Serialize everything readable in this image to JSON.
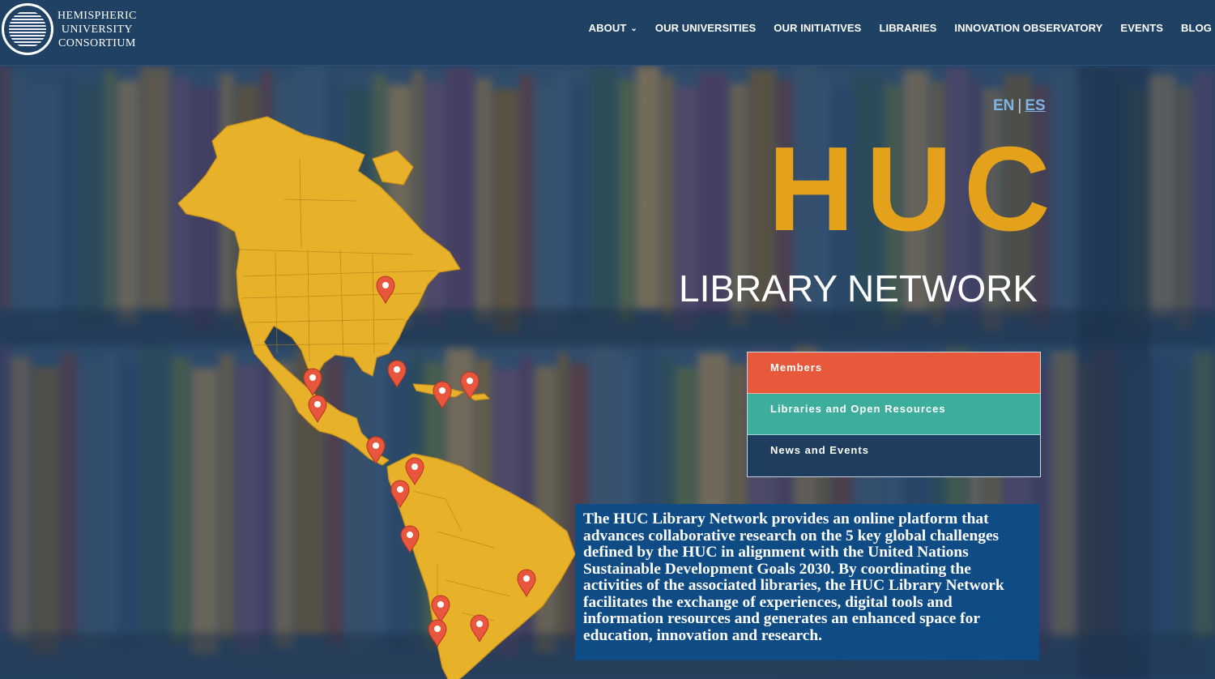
{
  "header": {
    "logo_lines": [
      "HEMISPHERIC",
      "UNIVERSITY",
      "CONSORTIUM"
    ],
    "nav": [
      {
        "label": "ABOUT",
        "has_dropdown": true
      },
      {
        "label": "OUR UNIVERSITIES"
      },
      {
        "label": "OUR INITIATIVES"
      },
      {
        "label": "LIBRARIES"
      },
      {
        "label": "INNOVATION OBSERVATORY"
      },
      {
        "label": "EVENTS"
      },
      {
        "label": "BLOG"
      }
    ]
  },
  "hero": {
    "lang": {
      "en": "EN",
      "separator": "|",
      "es": "ES"
    },
    "title": "HUC",
    "subtitle": "LIBRARY NETWORK",
    "menu": [
      {
        "label": "Members",
        "color": "#e8593b"
      },
      {
        "label": "Libraries and Open Resources",
        "color": "#3dae9c"
      },
      {
        "label": "News and Events",
        "color": "#1f3d5e"
      }
    ],
    "description": "The HUC Library Network provides an online platform that advances collaborative research on the 5 key global challenges defined by the HUC in alignment with the United Nations Sustainable Development Goals 2030. By coordinating the activities of the associated libraries, the HUC Library Network facilitates the exchange of experiences, digital tools and information resources and generates an enhanced space for education, innovation and research."
  },
  "colors": {
    "header_bg": "#1f4163",
    "title_gold": "#e4a11b",
    "map_gold": "#e8b12a",
    "pin_red": "#e8573d",
    "desc_bg": "#0f4c85"
  },
  "map_pin_count": 15
}
